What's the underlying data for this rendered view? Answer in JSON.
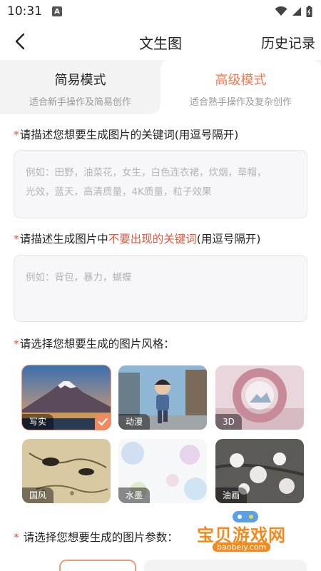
{
  "status_bar": {
    "time": "10:31",
    "badge": "A"
  },
  "nav": {
    "title": "文生图",
    "history": "历史记录"
  },
  "modes": [
    {
      "name": "简易模式",
      "desc": "适合新手操作及简易创作"
    },
    {
      "name": "高级模式",
      "desc": "适合熟手操作及复杂创作"
    }
  ],
  "accent_color": "#f07a50",
  "keywords": {
    "label": "请描述您想要生成图片的关键词(用逗号隔开)",
    "placeholder_line1": "例如：田野，油菜花，女生，白色连衣裙，炊烟，草帽，",
    "placeholder_line2": "光效，蓝天，高清质量，4K质量，粒子效果"
  },
  "negative": {
    "label_prefix": "请描述生成图片中",
    "label_highlight": "不要出现的关键词",
    "label_suffix": "(用逗号隔开)",
    "placeholder": "例如：背包，暴力，蝴蝶"
  },
  "style": {
    "label": "请选择您想要生成的图片风格：",
    "options": [
      {
        "label": "写实",
        "selected": true
      },
      {
        "label": "动漫",
        "selected": false
      },
      {
        "label": "3D",
        "selected": false
      },
      {
        "label": "国风",
        "selected": false
      },
      {
        "label": "水墨",
        "selected": false
      },
      {
        "label": "油画",
        "selected": false
      }
    ]
  },
  "params": {
    "label": "请选择您想要生成的图片参数："
  },
  "watermark": {
    "title": "宝贝游戏网",
    "url": "baobeiy.com"
  },
  "star": "*"
}
